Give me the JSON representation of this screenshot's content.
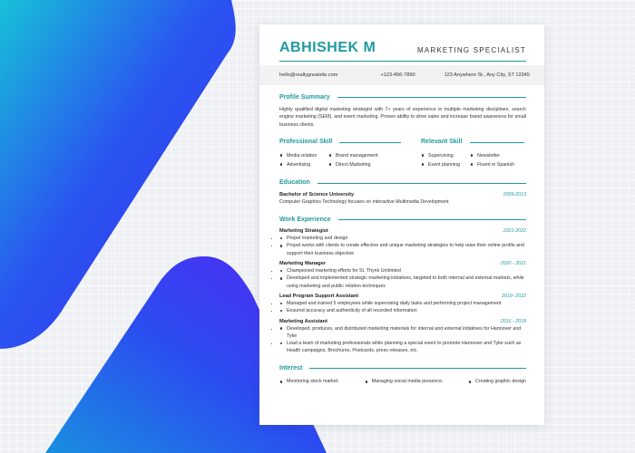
{
  "resume": {
    "name": "ABHISHEK M",
    "role": "MARKETING SPECIALIST",
    "contact": {
      "email": "hello@reallygreatsite.com",
      "phone": "+123-456-7890",
      "address": "123 Anywhere St., Any City, ST 12345"
    },
    "profile": {
      "title": "Profile Summary",
      "text": "Highly qualified digital marketing strategist with 7+ years of experience in multiple marketing disciplines, search engine marketing (SEM), and event marketing. Proven ability to drive sales and increase brand awareness for small business clients."
    },
    "professional_skill": {
      "title": "Professional Skill",
      "col1": [
        "Media relation",
        "Advertising"
      ],
      "col2": [
        "Brand management",
        "Direct Marketing"
      ]
    },
    "relevant_skill": {
      "title": "Relevant Skill",
      "col1": [
        "Supervising",
        "Event planning"
      ],
      "col2": [
        "Newsletter",
        "Fluent in Spanish"
      ]
    },
    "education": {
      "title": "Education",
      "degree": "Bachelor of Science University",
      "date": "2009-2013",
      "detail": "Computer Graphics Technology focuses on interactive Multimedia Development"
    },
    "experience": {
      "title": "Work Experience",
      "jobs": [
        {
          "title": "Marketing Strategist",
          "date": "2021-2022",
          "bullets": [
            "Propel marketing and design",
            "Propel works with clients to create effective and unique marketing strategies to help raise their online profile and support their business objective"
          ]
        },
        {
          "title": "Marketing Manager",
          "date": "2020 - 2021",
          "bullets": [
            "Championed marketing efforts for St. Thynk Unlimited",
            "Developed and implemented strategic marketing initiatives, targeted to both internal and external markets, while using marketing and public relation techniques"
          ]
        },
        {
          "title": "Lead Program Support Assistant",
          "date": "2019- 2022",
          "bullets": [
            "Managed and trained 5 employees while supervising daily tasks and performing project management",
            "Ensured accuracy and authenticity of all recorded information"
          ]
        },
        {
          "title": "Marketing Assistant",
          "date": "2016 - 2018",
          "bullets": [
            "Developed, produces, and distributed marketing materials for internal and external initiatives for Hannover and Tyke",
            "Lead a team of marketing professionals while planning a special event to promote Hannover and Tyke such as Health campaigns, Brochures, Postcards, press releases, etc."
          ]
        }
      ]
    },
    "interest": {
      "title": "Interest",
      "items": [
        "Monitoring stock market.",
        "Managing social media presence.",
        "Creating graphic design"
      ]
    }
  },
  "colors": {
    "accent": "#1f9aa0",
    "shape_top": "#2a3cf0",
    "shape_bottom": "#4a2cf5",
    "shape_teal": "#19b6d6"
  }
}
